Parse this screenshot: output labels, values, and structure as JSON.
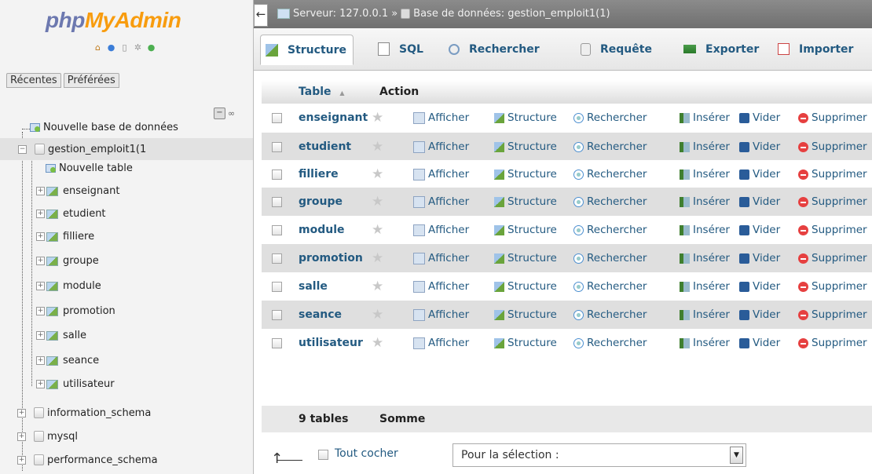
{
  "logo": {
    "part1": "php",
    "part2": "MyAdmin"
  },
  "top_icons": [
    "home-icon",
    "info-icon",
    "docs-icon",
    "settings-icon",
    "reload-icon"
  ],
  "sidebar": {
    "tabs": [
      "Récentes",
      "Préférées"
    ],
    "collapse_link": "∞",
    "new_database": "Nouvelle base de données",
    "current_db": "gestion_emploit1(1",
    "new_table": "Nouvelle table",
    "tables": [
      "enseignant",
      "etudient",
      "filliere",
      "groupe",
      "module",
      "promotion",
      "salle",
      "seance",
      "utilisateur"
    ],
    "other_dbs": [
      "information_schema",
      "mysql",
      "performance_schema"
    ]
  },
  "breadcrumb": {
    "server": "Serveur: 127.0.0.1",
    "separator": "»",
    "database": "Base de données: gestion_emploit1(1)"
  },
  "tabs": [
    "Structure",
    "SQL",
    "Rechercher",
    "Requête",
    "Exporter",
    "Importer"
  ],
  "table_header": {
    "table": "Table",
    "sort_indicator": "▲",
    "action": "Action"
  },
  "actions": [
    "Afficher",
    "Structure",
    "Rechercher",
    "Insérer",
    "Vider",
    "Supprimer"
  ],
  "rows": [
    "enseignant",
    "etudient",
    "filliere",
    "groupe",
    "module",
    "promotion",
    "salle",
    "seance",
    "utilisateur"
  ],
  "footer": {
    "count": "9 tables",
    "sum": "Somme"
  },
  "bulk": {
    "check_all": "Tout cocher",
    "selection_placeholder": "Pour la sélection :"
  },
  "colors": {
    "link": "#235a81",
    "logo_php": "#6c78af",
    "logo_admin": "#f89c0e",
    "delete": "#e64040"
  }
}
